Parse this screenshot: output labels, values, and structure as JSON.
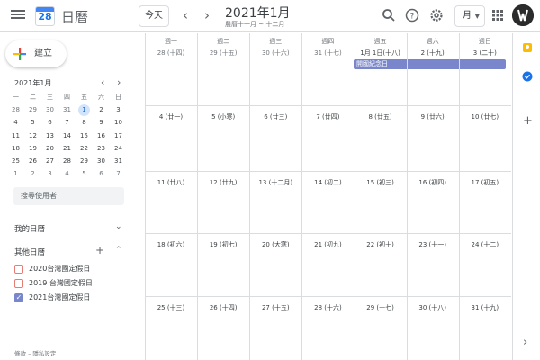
{
  "topbar": {
    "app_title": "日曆",
    "logo_day": "28",
    "today_label": "今天",
    "month_title": "2021年1月",
    "lunar_title": "農曆十一月 ~ 十二月",
    "view_label": "月"
  },
  "sidebar": {
    "create_label": "建立",
    "mini_month": "2021年1月",
    "mini_weekdays": [
      "一",
      "二",
      "三",
      "四",
      "五",
      "六",
      "日"
    ],
    "mini_weeks": [
      [
        "28",
        "29",
        "30",
        "31",
        "1",
        "2",
        "3"
      ],
      [
        "4",
        "5",
        "6",
        "7",
        "8",
        "9",
        "10"
      ],
      [
        "11",
        "12",
        "13",
        "14",
        "15",
        "16",
        "17"
      ],
      [
        "18",
        "19",
        "20",
        "21",
        "22",
        "23",
        "24"
      ],
      [
        "25",
        "26",
        "27",
        "28",
        "29",
        "30",
        "31"
      ],
      [
        "1",
        "2",
        "3",
        "4",
        "5",
        "6",
        "7"
      ]
    ],
    "search_placeholder": "搜尋使用者",
    "my_calendars": "我的日曆",
    "other_calendars": "其他日曆",
    "calendar_items": [
      {
        "label": "2020台灣國定假日",
        "checked": false,
        "color": "#e67c73"
      },
      {
        "label": "2019 台灣國定假日",
        "checked": false,
        "color": "#e67c73"
      },
      {
        "label": "2021台灣國定假日",
        "checked": true,
        "color": "#7986cb"
      }
    ],
    "footer": "條款 – 隱私設定"
  },
  "grid": {
    "weekdays": [
      "週一",
      "週二",
      "週三",
      "週四",
      "週五",
      "週六",
      "週日"
    ],
    "weeks": [
      [
        "28 (十四)",
        "29 (十五)",
        "30 (十六)",
        "31 (十七)",
        "1月 1日(十八)",
        "2 (十九)",
        "3 (二十)"
      ],
      [
        "4 (廿一)",
        "5 (小寒)",
        "6 (廿三)",
        "7 (廿四)",
        "8 (廿五)",
        "9 (廿六)",
        "10 (廿七)"
      ],
      [
        "11 (廿八)",
        "12 (廿九)",
        "13 (十二月)",
        "14 (初二)",
        "15 (初三)",
        "16 (初四)",
        "17 (初五)"
      ],
      [
        "18 (初六)",
        "19 (初七)",
        "20 (大寒)",
        "21 (初九)",
        "22 (初十)",
        "23 (十一)",
        "24 (十二)"
      ],
      [
        "25 (十三)",
        "26 (十四)",
        "27 (十五)",
        "28 (十六)",
        "29 (十七)",
        "30 (十八)",
        "31 (十九)"
      ]
    ],
    "event_label": "開國紀念日"
  },
  "colors": {
    "accent": "#1a73e8",
    "event": "#7986cb"
  }
}
